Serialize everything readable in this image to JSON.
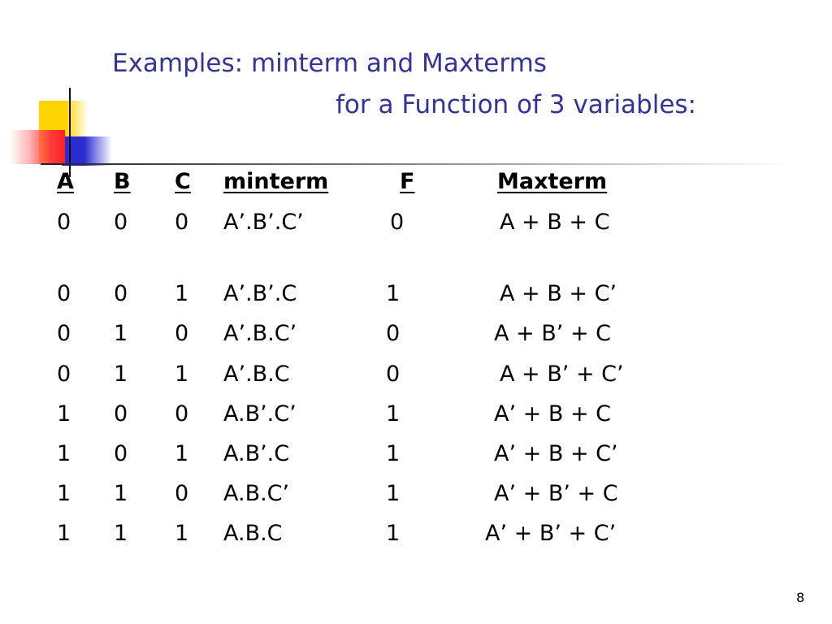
{
  "slide": {
    "title_line1": "Examples: minterm and Maxterms",
    "title_line2": "for a Function of 3 variables:",
    "page_number": "8"
  },
  "table": {
    "headers": [
      "A",
      "B",
      "C",
      "minterm",
      "F",
      "Maxterm"
    ],
    "rows": [
      [
        "0",
        "0",
        "0",
        "A’.B’.C’",
        "0",
        "A + B + C"
      ],
      [
        "0",
        "0",
        "1",
        "A’.B’.C",
        "1",
        "A + B + C’"
      ],
      [
        "0",
        "1",
        "0",
        "A’.B.C’",
        "0",
        "A + B’ + C"
      ],
      [
        "0",
        "1",
        "1",
        "A’.B.C",
        "0",
        "A + B’ + C’"
      ],
      [
        "1",
        "0",
        "0",
        "A.B’.C’",
        "1",
        "A’ + B + C"
      ],
      [
        "1",
        "0",
        "1",
        "A.B’.C",
        "1",
        "A’ + B + C’"
      ],
      [
        "1",
        "1",
        "0",
        "A.B.C’",
        "1",
        "A’ + B’ + C"
      ],
      [
        "1",
        "1",
        "1",
        "A.B.C",
        "1",
        "A’ + B’ + C’"
      ]
    ]
  },
  "colors": {
    "title": "#333399",
    "deco_yellow": "#ffd500",
    "deco_blue": "#2b2bd0",
    "deco_red": "#ff2020"
  }
}
